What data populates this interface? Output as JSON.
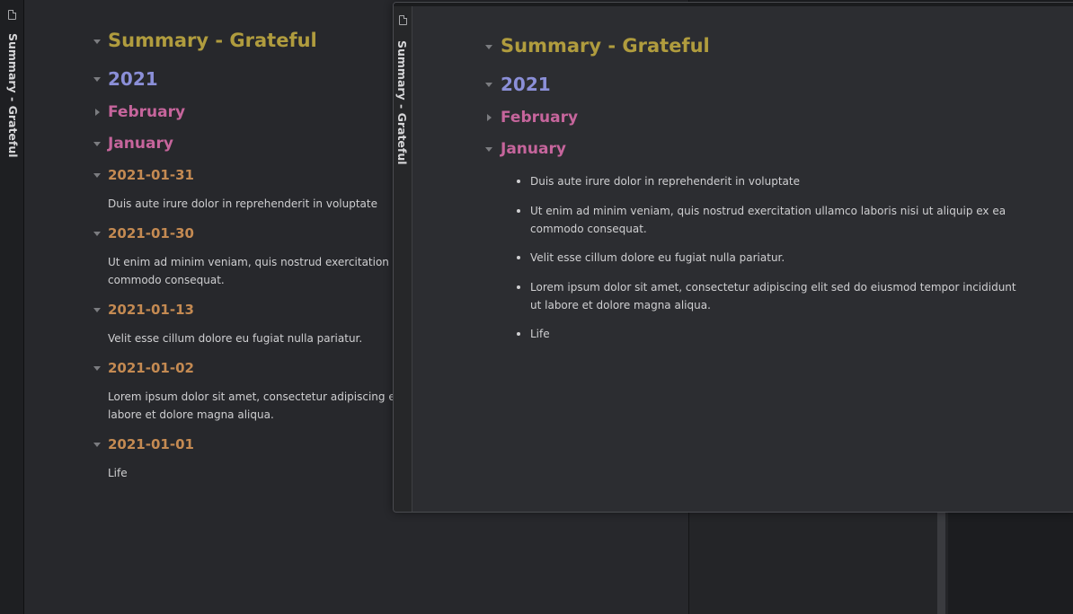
{
  "back": {
    "tab_title": "Summary - Grateful",
    "title": "Summary - Grateful",
    "year": "2021",
    "month_feb": "February",
    "month_jan": "January",
    "entries": [
      {
        "date": "2021-01-31",
        "text": "Duis aute irure dolor in reprehenderit in voluptate"
      },
      {
        "date": "2021-01-30",
        "text": "Ut enim ad minim veniam, quis nostrud exercitation ullamco laboris nisi ut aliquip ex ea commodo consequat."
      },
      {
        "date": "2021-01-13",
        "text": "Velit esse cillum dolore eu fugiat nulla pariatur."
      },
      {
        "date": "2021-01-02",
        "text": "Lorem ipsum dolor sit amet, consectetur adipiscing elit sed do eiusmod tempor incididunt ut labore et dolore magna aliqua."
      },
      {
        "date": "2021-01-01",
        "text": "Life"
      }
    ]
  },
  "front": {
    "tab_title": "Summary - Grateful",
    "title": "Summary - Grateful",
    "year": "2021",
    "month_feb": "February",
    "month_jan": "January",
    "bullets": [
      "Duis aute irure dolor in reprehenderit in voluptate",
      "Ut enim ad minim veniam, quis nostrud exercitation ullamco laboris nisi ut aliquip ex ea commodo consequat.",
      "Velit esse cillum dolore eu fugiat nulla pariatur.",
      "Lorem ipsum dolor sit amet, consectetur adipiscing elit sed do eiusmod tempor incididunt ut labore et dolore magna aliqua.",
      "Life"
    ]
  },
  "colors": {
    "h1": "#b09c3e",
    "h2": "#8b8fd8",
    "h3": "#c6659c",
    "h4": "#c48a52",
    "background": "#27282c"
  },
  "icons": {
    "file": "file-icon",
    "collapse": "chevron-down-icon",
    "expand": "chevron-right-icon"
  }
}
